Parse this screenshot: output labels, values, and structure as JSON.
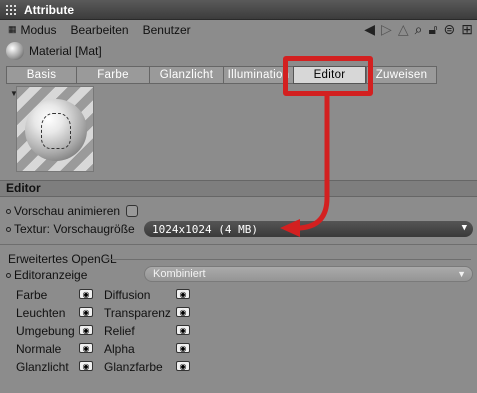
{
  "window": {
    "title": "Attribute"
  },
  "menu": {
    "items": [
      "Modus",
      "Bearbeiten",
      "Benutzer"
    ]
  },
  "toolbar_icons": [
    "back-arrow-icon",
    "forward-arrow-icon",
    "up-arrow-icon",
    "search-icon",
    "lock-icon",
    "settings-icon",
    "add-icon"
  ],
  "material": {
    "label": "Material [Mat]"
  },
  "tabs": [
    {
      "label": "Basis",
      "active": false
    },
    {
      "label": "Farbe",
      "active": false
    },
    {
      "label": "Glanzlicht",
      "active": false
    },
    {
      "label": "Illumination",
      "active": false
    },
    {
      "label": "Editor",
      "active": true
    },
    {
      "label": "Zuweisen",
      "active": false
    }
  ],
  "section": {
    "title": "Editor"
  },
  "props": {
    "animate_preview": {
      "label": "Vorschau animieren",
      "checked": false
    },
    "texture_preview_size": {
      "label": "Textur: Vorschaugröße",
      "value": "1024x1024 (4 MB)"
    }
  },
  "opengl": {
    "title": "Erweitertes OpenGL",
    "editor_display": {
      "label": "Editoranzeige",
      "value": "Kombiniert"
    },
    "channels_left": [
      "Farbe",
      "Leuchten",
      "Umgebung",
      "Normale",
      "Glanzlicht"
    ],
    "channels_right": [
      "Diffusion",
      "Transparenz",
      "Relief",
      "Alpha",
      "Glanzfarbe"
    ]
  },
  "colors": {
    "highlight": "#d32020",
    "panel": "#8c8c8c"
  }
}
